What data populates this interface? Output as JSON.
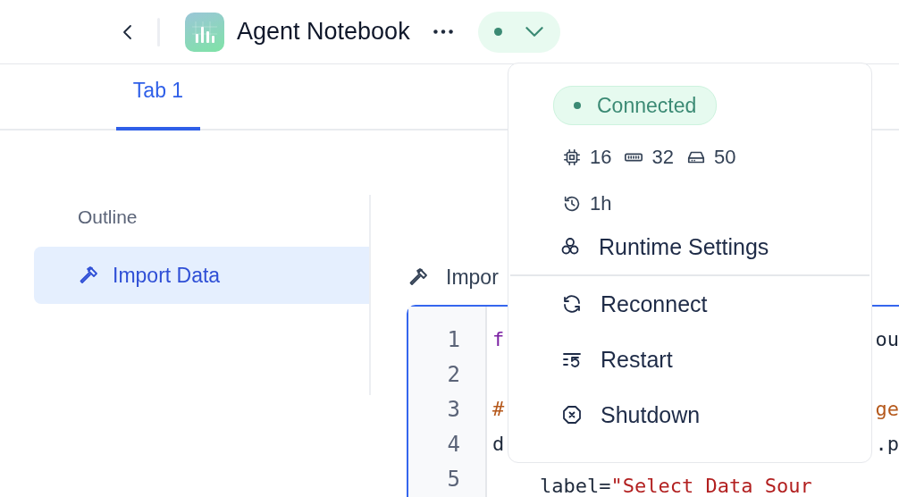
{
  "toolbar": {
    "title": "Agent Notebook",
    "status": {
      "connected": true
    }
  },
  "tabs": [
    {
      "label": "Tab 1",
      "selected": true
    }
  ],
  "outline": {
    "title": "Outline",
    "items": [
      {
        "label": "Import Data",
        "selected": true
      }
    ]
  },
  "cell": {
    "title": "Impor",
    "lines": [
      {
        "number": "1",
        "left": [
          {
            "kind": "keyword",
            "text": "f"
          }
        ],
        "right": [
          {
            "kind": "plain",
            "text": "ou"
          }
        ]
      },
      {
        "number": "2"
      },
      {
        "number": "3",
        "left": [
          {
            "kind": "comment",
            "text": "#"
          }
        ],
        "right": [
          {
            "kind": "comment",
            "text": "ge"
          }
        ]
      },
      {
        "number": "4",
        "left": [
          {
            "kind": "plain",
            "text": "d"
          }
        ],
        "right": [
          {
            "kind": "plain",
            "text": ".p"
          }
        ]
      },
      {
        "number": "5",
        "left": [
          {
            "kind": "plain",
            "text": "    label="
          },
          {
            "kind": "string",
            "text": "\"Select Data Sour"
          }
        ]
      }
    ]
  },
  "runtime_menu": {
    "status_label": "Connected",
    "resources": [
      {
        "kind": "cpu",
        "value": "16"
      },
      {
        "kind": "memory",
        "value": "32"
      },
      {
        "kind": "disk",
        "value": "50"
      }
    ],
    "uptime": "1h",
    "sections": [
      [
        {
          "kind": "settings",
          "label": "Runtime Settings"
        }
      ],
      [
        {
          "kind": "reconnect",
          "label": "Reconnect"
        },
        {
          "kind": "restart",
          "label": "Restart"
        },
        {
          "kind": "shutdown",
          "label": "Shutdown"
        }
      ]
    ]
  }
}
